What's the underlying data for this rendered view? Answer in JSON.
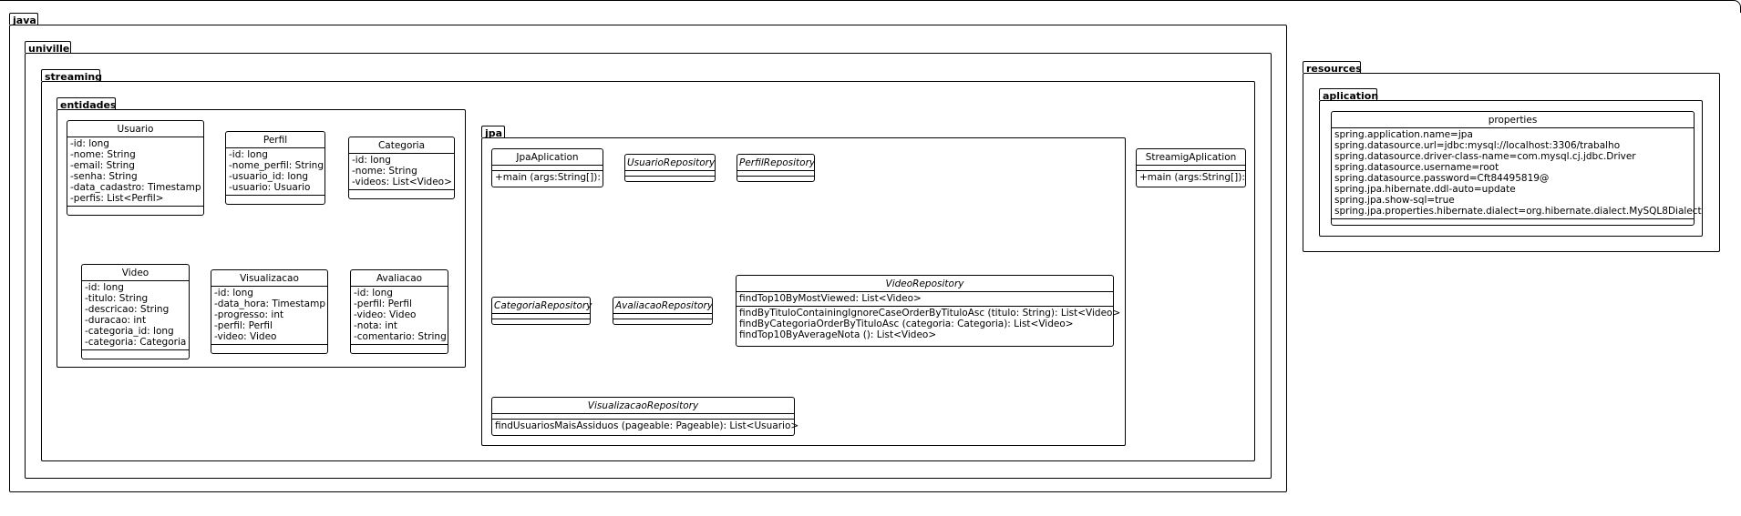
{
  "packages": {
    "java": "java",
    "univille": "univille",
    "streaming": "streaming",
    "entidades": "entidades",
    "jpa": "jpa",
    "resources": "resources",
    "aplication": "aplication"
  },
  "classes": {
    "usuario": {
      "name": "Usuario",
      "fields": [
        "-id: long",
        "-nome: String",
        "-email: String",
        "-senha: String",
        "-data_cadastro: Timestamp",
        "-perfis: List<Perfil>"
      ]
    },
    "perfil": {
      "name": "Perfil",
      "fields": [
        "-id: long",
        "-nome_perfil: String",
        "-usuario_id: long",
        "-usuario: Usuario"
      ]
    },
    "categoria": {
      "name": "Categoria",
      "fields": [
        "-id: long",
        "-nome: String",
        "-videos: List<Video>"
      ]
    },
    "video": {
      "name": "Video",
      "fields": [
        "-id: long",
        "-titulo: String",
        "-descricao: String",
        "-duracao: int",
        "-categoria_id: long",
        "-categoria: Categoria"
      ]
    },
    "visualizacao": {
      "name": "Visualizacao",
      "fields": [
        "-id: long",
        "-data_hora: Timestamp",
        "-progresso: int",
        "-perfil: Perfil",
        "-video: Video"
      ]
    },
    "avaliacao": {
      "name": "Avaliacao",
      "fields": [
        "-id: long",
        "-perfil: Perfil",
        "-video: Video",
        "-nota: int",
        "-comentario: String"
      ]
    },
    "jpa_aplication": {
      "name": "JpaAplication",
      "methods": [
        "+main (args:String[]):"
      ]
    },
    "usuario_repository": {
      "name": "UsuarioRepository"
    },
    "perfil_repository": {
      "name": "PerfilRepository"
    },
    "categoria_repository": {
      "name": "CategoriaRepository"
    },
    "avaliacao_repository": {
      "name": "AvaliacaoRepository"
    },
    "video_repository": {
      "name": "VideoRepository",
      "fields": [
        "findTop10ByMostViewed: List<Video>"
      ],
      "methods": [
        "findByTituloContainingIgnoreCaseOrderByTituloAsc (titulo: String): List<Video>",
        "findByCategoriaOrderByTituloAsc (categoria: Categoria): List<Video>",
        "findTop10ByAverageNota (): List<Video>"
      ]
    },
    "visualizacao_repository": {
      "name": "VisualizacaoRepository",
      "methods": [
        "findUsuariosMaisAssiduos (pageable: Pageable): List<Usuario>"
      ]
    },
    "streamig_aplication": {
      "name": "StreamigAplication",
      "methods": [
        "+main (args:String[]):"
      ]
    },
    "properties": {
      "name": "properties",
      "fields": [
        "spring.application.name=jpa",
        "spring.datasource.url=jdbc:mysql://localhost:3306/trabalho",
        "spring.datasource.driver-class-name=com.mysql.cj.jdbc.Driver",
        "spring.datasource.username=root",
        "spring.datasource.password=Cft84495819@",
        "spring.jpa.hibernate.ddl-auto=update",
        "spring.jpa.show-sql=true",
        "spring.jpa.properties.hibernate.dialect=org.hibernate.dialect.MySQL8Dialect"
      ]
    }
  }
}
